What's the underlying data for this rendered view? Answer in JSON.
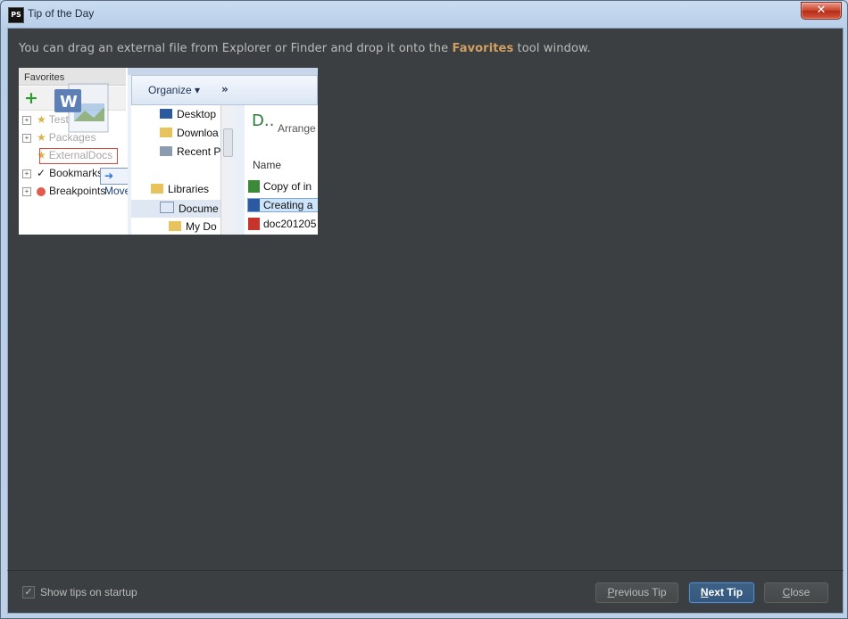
{
  "window": {
    "title": "Tip of the Day",
    "app_icon_text": "PS",
    "close_glyph": "✕"
  },
  "tip": {
    "text_before": "You can drag an external file from Explorer or Finder and drop it onto the ",
    "highlight": "Favorites",
    "text_after": " tool window."
  },
  "illustration": {
    "favorites_panel": {
      "title": "Favorites",
      "add_glyph": "+",
      "items": [
        {
          "label": "Test",
          "icon": "star-icon"
        },
        {
          "label": "Packages",
          "icon": "star-icon"
        },
        {
          "label": "ExternalDocs",
          "icon": "star-icon"
        },
        {
          "label": "Bookmarks",
          "icon": "checkmark-icon"
        },
        {
          "label": "Breakpoints",
          "icon": "red-dot-icon"
        }
      ],
      "move_tooltip": "Move",
      "move_arrow": "➔"
    },
    "explorer": {
      "organize_label": "Organize ▾",
      "more_label": "»",
      "nav_items": [
        {
          "label": "Desktop"
        },
        {
          "label": "Downloa"
        },
        {
          "label": "Recent P"
        },
        {
          "label": "Libraries"
        },
        {
          "label": "Docume"
        },
        {
          "label": "My Do"
        }
      ],
      "pane_title": "D..",
      "arrange_label": "Arrange",
      "name_column": "Name",
      "files": [
        {
          "label": "Copy of in"
        },
        {
          "label": "Creating a"
        },
        {
          "label": "doc201205"
        }
      ]
    }
  },
  "footer": {
    "show_tips_label": "Show tips on startup",
    "show_tips_checked": true,
    "check_glyph": "✓",
    "previous_tip_mnemonic": "P",
    "previous_tip_rest": "revious Tip",
    "next_tip_mnemonic": "N",
    "next_tip_rest": "ext Tip",
    "close_mnemonic": "C",
    "close_rest": "lose"
  }
}
